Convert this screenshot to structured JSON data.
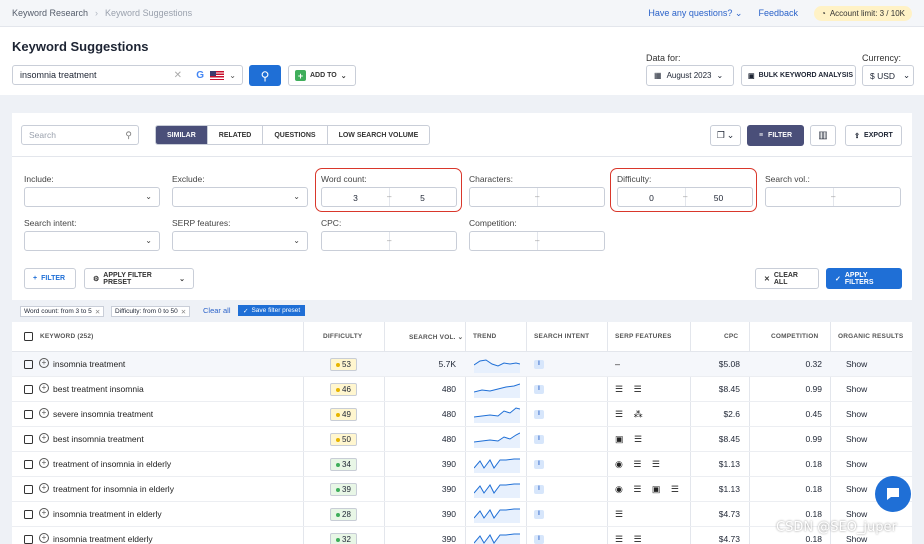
{
  "topbar": {
    "crumb1": "Keyword Research",
    "crumb2": "Keyword Suggestions",
    "questions": "Have any questions?",
    "feedback": "Feedback",
    "account_limit": "Account limit: 3 / 10K"
  },
  "header": {
    "title": "Keyword Suggestions",
    "search_value": "insomnia treatment",
    "add_to": "ADD TO",
    "data_for_label": "Data for:",
    "date": "August 2023",
    "bulk": "BULK KEYWORD ANALYSIS",
    "currency_label": "Currency:",
    "currency": "$ USD"
  },
  "toolbar": {
    "search_placeholder": "Search",
    "tabs": [
      "SIMILAR",
      "RELATED",
      "QUESTIONS",
      "LOW SEARCH VOLUME"
    ],
    "active_tab": "SIMILAR",
    "filter": "FILTER",
    "export": "EXPORT"
  },
  "filters": {
    "include": "Include:",
    "exclude": "Exclude:",
    "word_count": "Word count:",
    "word_count_from": "3",
    "word_count_to": "5",
    "characters": "Characters:",
    "difficulty": "Difficulty:",
    "difficulty_from": "0",
    "difficulty_to": "50",
    "search_vol": "Search vol.:",
    "search_intent": "Search intent:",
    "serp_features": "SERP features:",
    "cpc": "CPC:",
    "competition": "Competition:",
    "add_filter": "FILTER",
    "apply_preset": "APPLY FILTER PRESET",
    "clear_all": "CLEAR ALL",
    "apply_filters": "APPLY FILTERS"
  },
  "tags": {
    "tag1": "Word count: from 3 to 5",
    "tag2": "Difficulty: from 0 to 50",
    "clear_all": "Clear all",
    "save_preset": "Save filter preset"
  },
  "table": {
    "headers": {
      "keyword": "KEYWORD (252)",
      "difficulty": "DIFFICULTY",
      "volume": "SEARCH VOL.",
      "trend": "TREND",
      "intent": "SEARCH INTENT",
      "serp": "SERP FEATURES",
      "cpc": "CPC",
      "competition": "COMPETITION",
      "organic": "ORGANIC RESULTS"
    },
    "rows": [
      {
        "keyword": "insomnia treatment",
        "difficulty": "53",
        "volume": "5.7K",
        "intent": "I",
        "serp": "–",
        "cpc": "$5.08",
        "competition": "0.32",
        "organic": "Show"
      },
      {
        "keyword": "best treatment insomnia",
        "difficulty": "46",
        "volume": "480",
        "intent": "I",
        "serp": "☰ ☰",
        "cpc": "$8.45",
        "competition": "0.99",
        "organic": "Show"
      },
      {
        "keyword": "severe insomnia treatment",
        "difficulty": "49",
        "volume": "480",
        "intent": "I",
        "serp": "☰ ⁂",
        "cpc": "$2.6",
        "competition": "0.45",
        "organic": "Show"
      },
      {
        "keyword": "best insomnia treatment",
        "difficulty": "50",
        "volume": "480",
        "intent": "I",
        "serp": "▣ ☰",
        "cpc": "$8.45",
        "competition": "0.99",
        "organic": "Show"
      },
      {
        "keyword": "treatment of insomnia in elderly",
        "difficulty": "34",
        "volume": "390",
        "intent": "I",
        "serp": "◉ ☰ ☰",
        "cpc": "$1.13",
        "competition": "0.18",
        "organic": "Show"
      },
      {
        "keyword": "treatment for insomnia in elderly",
        "difficulty": "39",
        "volume": "390",
        "intent": "I",
        "serp": "◉ ☰ ▣ ☰",
        "cpc": "$1.13",
        "competition": "0.18",
        "organic": "Show"
      },
      {
        "keyword": "insomnia treatment in elderly",
        "difficulty": "28",
        "volume": "390",
        "intent": "I",
        "serp": "☰",
        "cpc": "$4.73",
        "competition": "0.18",
        "organic": "Show"
      },
      {
        "keyword": "insomnia treatment elderly",
        "difficulty": "32",
        "volume": "390",
        "intent": "I",
        "serp": "☰ ☰",
        "cpc": "$4.73",
        "competition": "0.18",
        "organic": "Show"
      }
    ]
  },
  "watermark": "CSDN @SEO_juper",
  "colors": {
    "accent": "#1f6fd6",
    "dark_accent": "#4a4f79",
    "highlight": "#d9372b"
  }
}
